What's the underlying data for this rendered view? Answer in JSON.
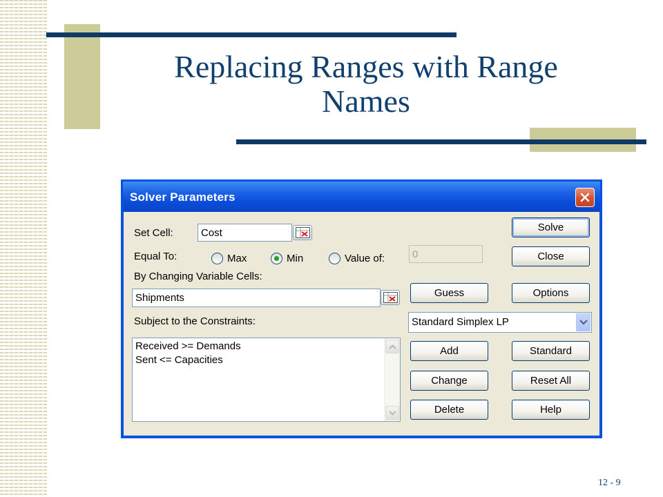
{
  "slide": {
    "title_line1": "Replacing Ranges with Range",
    "title_line2": "Names",
    "page_number": "12 - 9"
  },
  "dialog": {
    "title": "Solver Parameters",
    "set_cell": {
      "label": "Set Cell:",
      "value": "Cost"
    },
    "equal_to": {
      "label": "Equal To:",
      "options": [
        "Max",
        "Min",
        "Value of:"
      ],
      "selected": "Min",
      "value_of": "0"
    },
    "changing_cells": {
      "label": "By Changing Variable Cells:",
      "value": "Shipments"
    },
    "constraints": {
      "label": "Subject to the Constraints:",
      "items": [
        "Received >= Demands",
        "Sent <= Capacities"
      ]
    },
    "engine": {
      "selected": "Standard Simplex LP"
    },
    "buttons": {
      "solve": "Solve",
      "close": "Close",
      "guess": "Guess",
      "options": "Options",
      "add": "Add",
      "standard": "Standard",
      "change": "Change",
      "reset_all": "Reset All",
      "delete": "Delete",
      "help": "Help"
    }
  },
  "colors": {
    "title_text": "#12406e",
    "rule": "#0f3a66",
    "accent_tan": "#cccc99",
    "dialog_face": "#ece9d8",
    "titlebar": "#0a4bd8"
  }
}
